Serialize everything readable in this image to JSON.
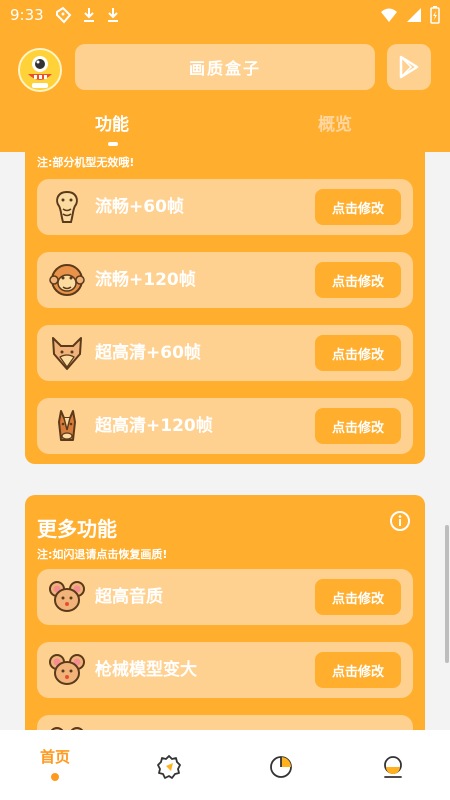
{
  "status_bar": {
    "time": "9:33",
    "icons": [
      "ticket-icon",
      "download-icon",
      "download-icon",
      "wifi-icon",
      "signal-icon",
      "battery-charging-icon"
    ]
  },
  "header": {
    "title": "画质盒子",
    "avatar_icon": "cartoon-mascot-avatar",
    "play_icon": "play-store-icon",
    "tabs": [
      {
        "label": "功能",
        "active": true
      },
      {
        "label": "概览",
        "active": false
      }
    ]
  },
  "card1": {
    "note": "注:部分机型无效哦!",
    "rows": [
      {
        "label": "流畅+60帧",
        "button": "点击修改",
        "icon": "cobra-icon"
      },
      {
        "label": "流畅+120帧",
        "button": "点击修改",
        "icon": "monkey-icon"
      },
      {
        "label": "超高清+60帧",
        "button": "点击修改",
        "icon": "wolf-icon"
      },
      {
        "label": "超高清+120帧",
        "button": "点击修改",
        "icon": "horse-icon"
      }
    ]
  },
  "card2": {
    "title": "更多功能",
    "note": "注:如闪退请点击恢复画质!",
    "info_icon": "info-icon",
    "rows": [
      {
        "label": "超高音质",
        "button": "点击修改",
        "icon": "mouse-icon"
      },
      {
        "label": "枪械模型变大",
        "button": "点击修改",
        "icon": "mouse-icon"
      }
    ]
  },
  "bottom_nav": {
    "items": [
      {
        "label": "首页",
        "icon": "home",
        "active": true
      },
      {
        "label": "",
        "icon": "badge-check-icon",
        "active": false
      },
      {
        "label": "",
        "icon": "pie-chart-icon",
        "active": false
      },
      {
        "label": "",
        "icon": "user-icon",
        "active": false
      }
    ]
  },
  "colors": {
    "primary": "#ffae2e",
    "row_bg": "#ffd190",
    "accent": "#ff9a1f",
    "icon_stroke": "#5a3a1a"
  }
}
